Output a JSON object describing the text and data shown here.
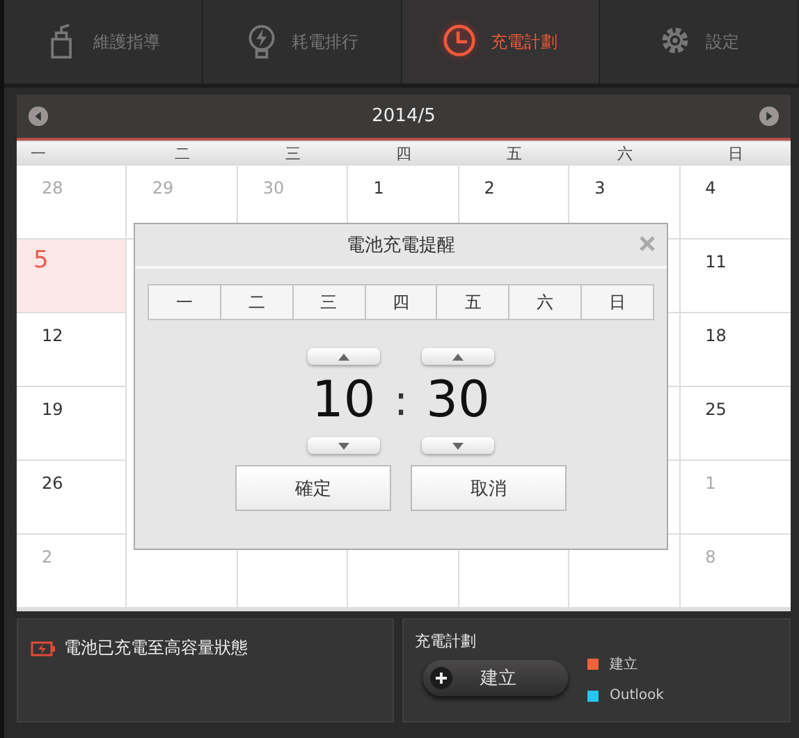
{
  "tabs": [
    {
      "label": "維護指導",
      "selected": false
    },
    {
      "label": "耗電排行",
      "selected": false
    },
    {
      "label": "充電計劃",
      "selected": true
    },
    {
      "label": "設定",
      "selected": false
    }
  ],
  "calendar": {
    "month": "2014/5",
    "weekdays": [
      "一",
      "二",
      "三",
      "四",
      "五",
      "六",
      "日"
    ],
    "weeks": [
      {
        "mon": {
          "day": "28",
          "other_month": true,
          "selected": false
        },
        "tue": {
          "day": "29",
          "other_month": true,
          "selected": false
        },
        "wed": {
          "day": "30",
          "other_month": true,
          "selected": false
        },
        "thu": {
          "day": "1",
          "other_month": false,
          "selected": false
        },
        "fri": {
          "day": "2",
          "other_month": false,
          "selected": false
        },
        "sat": {
          "day": "3",
          "other_month": false,
          "selected": false
        },
        "sun": {
          "day": "4",
          "other_month": false,
          "selected": false
        }
      },
      {
        "mon": {
          "day": "5",
          "other_month": false,
          "selected": true
        },
        "sun": {
          "day": "11",
          "other_month": false,
          "selected": false
        }
      },
      {
        "mon": {
          "day": "12",
          "other_month": false,
          "selected": false
        },
        "sun": {
          "day": "18",
          "other_month": false,
          "selected": false
        }
      },
      {
        "mon": {
          "day": "19",
          "other_month": false,
          "selected": false
        },
        "sun": {
          "day": "25",
          "other_month": false,
          "selected": false
        }
      },
      {
        "mon": {
          "day": "26",
          "other_month": false,
          "selected": false
        },
        "sun": {
          "day": "1",
          "other_month": true,
          "selected": false
        }
      },
      {
        "mon": {
          "day": "2",
          "other_month": true,
          "selected": false
        },
        "sun": {
          "day": "8",
          "other_month": true,
          "selected": false
        }
      }
    ]
  },
  "dialog": {
    "title": "電池充電提醒",
    "days": [
      {
        "label": "一",
        "selected": false
      },
      {
        "label": "二",
        "selected": false
      },
      {
        "label": "三",
        "selected": false
      },
      {
        "label": "四",
        "selected": false
      },
      {
        "label": "五",
        "selected": false
      },
      {
        "label": "六",
        "selected": false
      },
      {
        "label": "日",
        "selected": false
      }
    ],
    "hour": "10",
    "separator": ":",
    "minute": "30",
    "buttons": [
      "確定",
      "取消"
    ]
  },
  "status": {
    "text": "電池已充電至高容量狀態"
  },
  "plan": {
    "title": "充電計劃",
    "button": "建立",
    "legend": [
      {
        "label": "建立",
        "color": "#f0623c"
      },
      {
        "label": "Outlook",
        "color": "#27c4ec"
      }
    ]
  }
}
